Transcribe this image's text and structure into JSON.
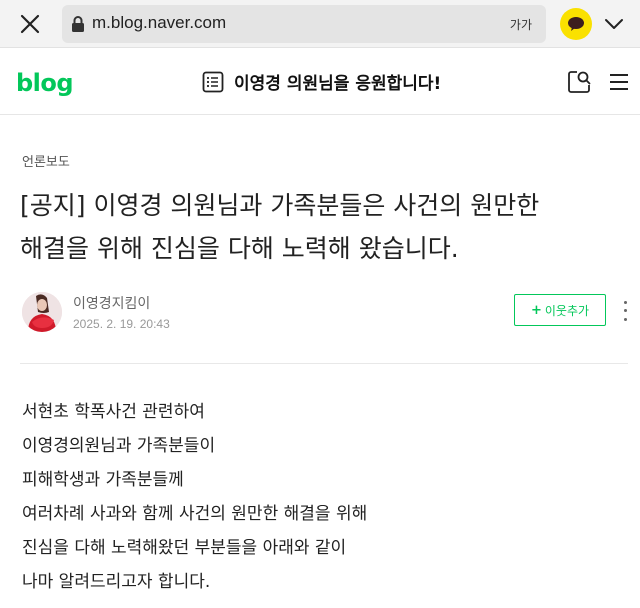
{
  "browser": {
    "url": "m.blog.naver.com",
    "text_size_label": "가가"
  },
  "blog": {
    "logo": "blog",
    "title": "이영경 의원님을 응원합니다!"
  },
  "post": {
    "category": "언론보도",
    "title_lines": [
      "[공지] 이영경 의원님과 가족분들은 사건의 원만한",
      "해결을 위해 진심을 다해 노력해 왔습니다."
    ],
    "author": "이영경지킴이",
    "date": "2025. 2. 19. 20:43",
    "follow_label": "이웃추가",
    "body_lines": [
      "서현초 학폭사건 관련하여",
      "이영경의원님과 가족분들이",
      "피해학생과 가족분들께",
      "여러차례 사과와 함께 사건의 원만한 해결을 위해",
      "진심을 다해 노력해왔던 부분들을 아래와 같이",
      "나마 알려드리고자 합니다."
    ]
  },
  "colors": {
    "brand_green": "#03c75a",
    "kakao_yellow": "#fae100"
  },
  "icons": [
    "close-icon",
    "lock-icon",
    "kakaotalk-icon",
    "chevron-down-icon",
    "list-icon",
    "search-icon",
    "menu-icon",
    "more-icon"
  ]
}
